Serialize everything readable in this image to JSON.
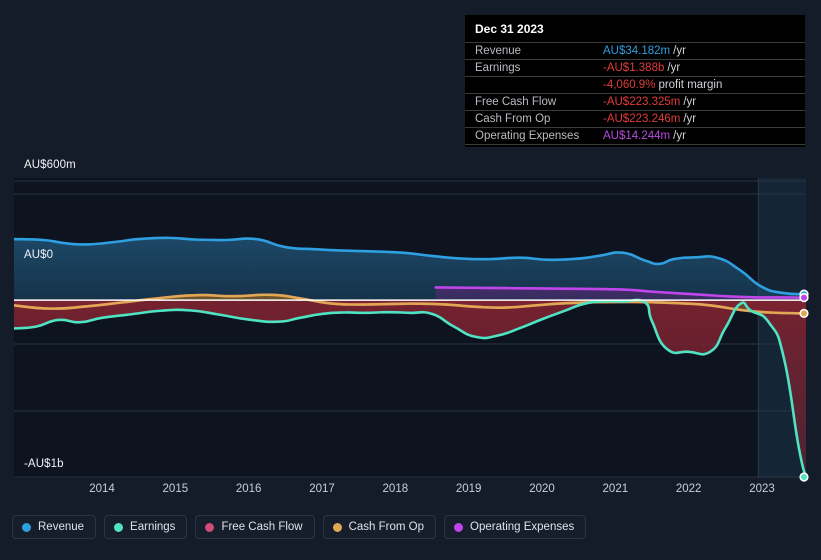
{
  "chart_data": {
    "type": "area",
    "title": "",
    "xlabel": "",
    "ylabel": "",
    "currency": "AU$",
    "grid": true,
    "legend_position": "bottom",
    "ylim": [
      -1000000000,
      600000000
    ],
    "y_ticks": [
      {
        "label": "AU$600m",
        "value": 600000000
      },
      {
        "label": "AU$0",
        "value": 0
      },
      {
        "label": "-AU$1b",
        "value": -1000000000
      }
    ],
    "x_ticks": [
      "2014",
      "2015",
      "2016",
      "2017",
      "2018",
      "2019",
      "2020",
      "2021",
      "2022",
      "2023"
    ],
    "x_range": [
      2013.3,
      2024.1
    ],
    "highlight_band": {
      "from": 2023.45,
      "to": 2024.1
    },
    "series": [
      {
        "name": "Revenue",
        "color": "#2e9fe0",
        "fill": "#1d4b6b",
        "end_value": 34182000,
        "points": [
          [
            2013.3,
            345
          ],
          [
            2013.7,
            340
          ],
          [
            2014.0,
            322
          ],
          [
            2014.3,
            315
          ],
          [
            2014.7,
            330
          ],
          [
            2015.0,
            345
          ],
          [
            2015.4,
            352
          ],
          [
            2015.8,
            342
          ],
          [
            2016.2,
            340
          ],
          [
            2016.6,
            345
          ],
          [
            2017.0,
            300
          ],
          [
            2017.4,
            288
          ],
          [
            2017.8,
            280
          ],
          [
            2018.2,
            275
          ],
          [
            2018.6,
            268
          ],
          [
            2019.0,
            250
          ],
          [
            2019.4,
            235
          ],
          [
            2019.8,
            232
          ],
          [
            2020.2,
            240
          ],
          [
            2020.6,
            228
          ],
          [
            2021.0,
            235
          ],
          [
            2021.3,
            252
          ],
          [
            2021.6,
            268
          ],
          [
            2021.9,
            225
          ],
          [
            2022.1,
            205
          ],
          [
            2022.3,
            232
          ],
          [
            2022.6,
            242
          ],
          [
            2022.9,
            238
          ],
          [
            2023.2,
            170
          ],
          [
            2023.5,
            75
          ],
          [
            2023.8,
            40
          ],
          [
            2024.1,
            34
          ]
        ]
      },
      {
        "name": "Earnings",
        "color": "#4fe3c3",
        "fill": "#7a2230",
        "end_value": -1388000000,
        "points": [
          [
            2013.3,
            -160
          ],
          [
            2013.6,
            -150
          ],
          [
            2013.9,
            -112
          ],
          [
            2014.2,
            -125
          ],
          [
            2014.5,
            -100
          ],
          [
            2014.9,
            -80
          ],
          [
            2015.3,
            -60
          ],
          [
            2015.7,
            -58
          ],
          [
            2016.1,
            -82
          ],
          [
            2016.5,
            -110
          ],
          [
            2016.9,
            -122
          ],
          [
            2017.2,
            -100
          ],
          [
            2017.5,
            -78
          ],
          [
            2017.8,
            -70
          ],
          [
            2018.1,
            -72
          ],
          [
            2018.4,
            -68
          ],
          [
            2018.7,
            -72
          ],
          [
            2019.0,
            -78
          ],
          [
            2019.3,
            -150
          ],
          [
            2019.6,
            -208
          ],
          [
            2019.9,
            -200
          ],
          [
            2020.2,
            -158
          ],
          [
            2020.5,
            -108
          ],
          [
            2020.8,
            -62
          ],
          [
            2021.1,
            -18
          ],
          [
            2021.4,
            -6
          ],
          [
            2021.6,
            -8
          ],
          [
            2021.9,
            -12
          ],
          [
            2022.0,
            -120
          ],
          [
            2022.2,
            -275
          ],
          [
            2022.5,
            -292
          ],
          [
            2022.8,
            -290
          ],
          [
            2023.0,
            -158
          ],
          [
            2023.2,
            -22
          ],
          [
            2023.35,
            -60
          ],
          [
            2023.6,
            -130
          ],
          [
            2023.8,
            -330
          ],
          [
            2024.0,
            -830
          ],
          [
            2024.1,
            -1000
          ]
        ]
      },
      {
        "name": "Free Cash Flow",
        "color": "#d14a7a",
        "fill": "#8c2030",
        "end_value": -223325000,
        "points": [
          [
            2013.3,
            -30
          ],
          [
            2013.8,
            -48
          ],
          [
            2014.3,
            -35
          ],
          [
            2014.8,
            -12
          ],
          [
            2015.3,
            12
          ],
          [
            2015.8,
            28
          ],
          [
            2016.3,
            22
          ],
          [
            2016.8,
            30
          ],
          [
            2017.2,
            10
          ],
          [
            2017.6,
            -18
          ],
          [
            2018.0,
            -25
          ],
          [
            2018.4,
            -22
          ],
          [
            2018.8,
            -20
          ],
          [
            2019.2,
            -25
          ],
          [
            2019.6,
            -38
          ],
          [
            2020.0,
            -42
          ],
          [
            2020.4,
            -30
          ],
          [
            2020.8,
            -18
          ],
          [
            2021.2,
            -12
          ],
          [
            2021.6,
            -10
          ],
          [
            2022.0,
            -12
          ],
          [
            2022.4,
            -18
          ],
          [
            2022.8,
            -30
          ],
          [
            2023.2,
            -55
          ],
          [
            2023.6,
            -70
          ],
          [
            2024.1,
            -75
          ]
        ]
      },
      {
        "name": "Cash From Op",
        "color": "#e0a852",
        "fill": "#6b5a2a",
        "end_value": -223246000,
        "points": [
          [
            2013.3,
            -30
          ],
          [
            2013.8,
            -48
          ],
          [
            2014.3,
            -35
          ],
          [
            2014.8,
            -12
          ],
          [
            2015.3,
            12
          ],
          [
            2015.8,
            28
          ],
          [
            2016.3,
            22
          ],
          [
            2016.8,
            30
          ],
          [
            2017.2,
            10
          ],
          [
            2017.6,
            -18
          ],
          [
            2018.0,
            -25
          ],
          [
            2018.4,
            -22
          ],
          [
            2018.8,
            -20
          ],
          [
            2019.2,
            -25
          ],
          [
            2019.6,
            -38
          ],
          [
            2020.0,
            -42
          ],
          [
            2020.4,
            -30
          ],
          [
            2020.8,
            -18
          ],
          [
            2021.2,
            -12
          ],
          [
            2021.6,
            -10
          ],
          [
            2022.0,
            -12
          ],
          [
            2022.4,
            -18
          ],
          [
            2022.8,
            -30
          ],
          [
            2023.2,
            -55
          ],
          [
            2023.6,
            -70
          ],
          [
            2024.1,
            -75
          ]
        ]
      },
      {
        "name": "Operating Expenses",
        "color": "#c046ec",
        "fill": "#4a2a6b",
        "end_value": 14244000,
        "points": [
          [
            2019.05,
            72
          ],
          [
            2019.5,
            70
          ],
          [
            2020.0,
            68
          ],
          [
            2020.5,
            66
          ],
          [
            2021.0,
            64
          ],
          [
            2021.4,
            62
          ],
          [
            2021.7,
            58
          ],
          [
            2022.0,
            48
          ],
          [
            2022.3,
            40
          ],
          [
            2022.7,
            30
          ],
          [
            2023.0,
            22
          ],
          [
            2023.4,
            16
          ],
          [
            2023.8,
            15
          ],
          [
            2024.1,
            14
          ]
        ]
      }
    ]
  },
  "tooltip": {
    "title": "Dec 31 2023",
    "rows": [
      {
        "label": "Revenue",
        "value": "AU$34.182m",
        "unit": "/yr",
        "color": "#2e9fe0"
      },
      {
        "label": "Earnings",
        "value": "-AU$1.388b",
        "unit": "/yr",
        "color": "#e03c3c"
      },
      {
        "label": "",
        "value": "-4,060.9%",
        "sub": "profit margin",
        "color": "#e03c3c"
      },
      {
        "label": "Free Cash Flow",
        "value": "-AU$223.325m",
        "unit": "/yr",
        "color": "#e03c3c"
      },
      {
        "label": "Cash From Op",
        "value": "-AU$223.246m",
        "unit": "/yr",
        "color": "#e03c3c"
      },
      {
        "label": "Operating Expenses",
        "value": "AU$14.244m",
        "unit": "/yr",
        "color": "#b84ae0"
      }
    ]
  },
  "legend": {
    "items": [
      {
        "label": "Revenue",
        "color": "#2e9fe0"
      },
      {
        "label": "Earnings",
        "color": "#4fe3c3"
      },
      {
        "label": "Free Cash Flow",
        "color": "#d14a7a"
      },
      {
        "label": "Cash From Op",
        "color": "#e0a852"
      },
      {
        "label": "Operating Expenses",
        "color": "#c046ec"
      }
    ]
  },
  "axis": {
    "y_top_label": "AU$600m",
    "y_zero_label": "AU$0",
    "y_bottom_label": "-AU$1b"
  },
  "colors": {
    "background": "#141b29",
    "plot_background": "#0d1420",
    "gridline": "#2a3242",
    "zero_line": "#ffffff"
  }
}
